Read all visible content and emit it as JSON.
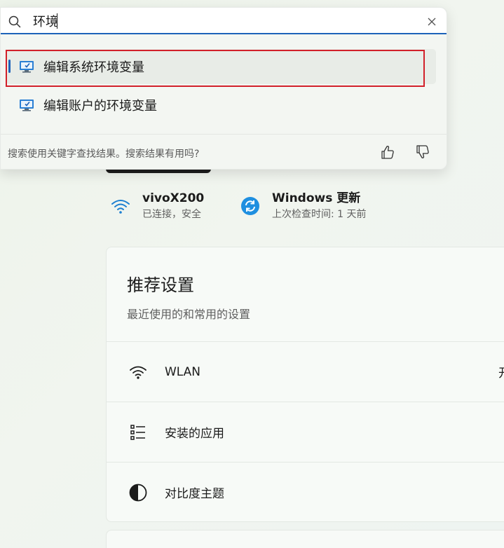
{
  "search": {
    "query": "环境",
    "results": [
      {
        "label": "编辑系统环境变量",
        "icon": "system-properties-icon",
        "selected": true
      },
      {
        "label": "编辑账户的环境变量",
        "icon": "system-properties-icon",
        "selected": false
      }
    ],
    "feedback_prompt": "搜索使用关键字查找结果。搜索结果有用吗?"
  },
  "status": {
    "wifi": {
      "title": "vivoX200",
      "subtitle": "已连接，安全",
      "icon": "wifi-icon"
    },
    "update": {
      "title": "Windows 更新",
      "subtitle": "上次检查时间: 1 天前",
      "icon": "refresh-icon"
    }
  },
  "recommended": {
    "title": "推荐设置",
    "subtitle": "最近使用的和常用的设置",
    "items": [
      {
        "label": "WLAN",
        "value": "开",
        "icon": "wifi-icon"
      },
      {
        "label": "安装的应用",
        "value": "",
        "icon": "app-list-icon"
      },
      {
        "label": "对比度主题",
        "value": "",
        "icon": "contrast-icon"
      }
    ]
  },
  "colors": {
    "accent": "#1d63b9",
    "highlight_border": "#d2202a"
  }
}
